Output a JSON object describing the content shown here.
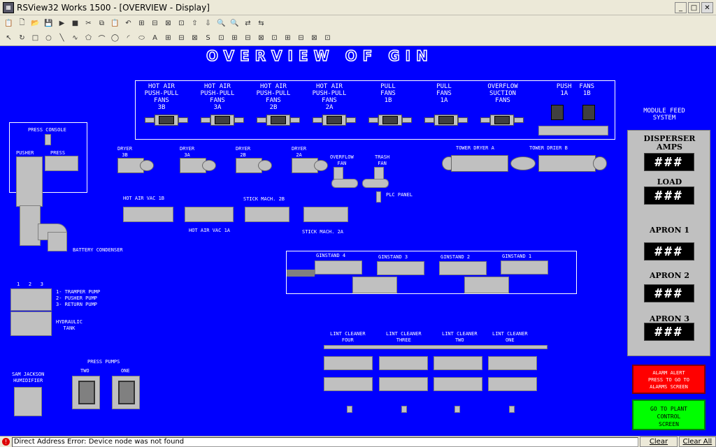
{
  "window": {
    "title": "RSView32 Works 1500 - [OVERVIEW - Display]",
    "min": "_",
    "max": "□",
    "close": "✕"
  },
  "toolbar1": [
    "📋",
    "🗋",
    "📂",
    "💾",
    "▶",
    "■",
    "✂",
    "⧉",
    "📋",
    "↶",
    "⊞",
    "⊟",
    "⊠",
    "⊡",
    "⇧",
    "⇩",
    "🔍",
    "🔍",
    "⇄",
    "⇆"
  ],
  "toolbar2": [
    "↖",
    "↻",
    "□",
    "○",
    "╲",
    "∿",
    "⬠",
    "⌒",
    "◯",
    "◜",
    "⬭",
    "A",
    "⊞",
    "⊟",
    "⊠",
    "S",
    "⊡",
    "⊞",
    "⊟",
    "⊠",
    "⊡",
    "⊞",
    "⊟",
    "⊠",
    "⊡"
  ],
  "screen": {
    "title": "OVERVIEW OF GIN",
    "fans": [
      "HOT AIR\nPUSH-PULL\nFANS\n3B",
      "HOT AIR\nPUSH-PULL\nFANS\n3A",
      "HOT AIR\nPUSH-PULL\nFANS\n2B",
      "HOT AIR\nPUSH-PULL\nFANS\n2A",
      "PULL\nFANS\n1B",
      "PULL\nFANS\n1A",
      "OVERFLOW\nSUCTION\nFANS",
      "PUSH  FANS\n1A    1B"
    ],
    "press_console": "PRESS CONSOLE",
    "pusher": "PUSHER",
    "press": "PRESS",
    "dryers": [
      "DRYER\n3B",
      "DRYER\n3A",
      "DRYER\n2B",
      "DRYER\n2A"
    ],
    "overflow_fan": "OVERFLOW\nFAN",
    "trash_fan": "TRASH\nFAN",
    "plc_panel": "PLC PANEL",
    "tower_dryer_a": "TOWER DRYER A",
    "tower_drier_b": "TOWER DRIER B",
    "hot_air_vac_1b": "HOT AIR VAC 1B",
    "hot_air_vac_1a": "HOT AIR VAC 1A",
    "stick_mach_2b": "STICK MACH. 2B",
    "stick_mach_2a": "STICK MACH. 2A",
    "battery_condenser": "BATTERY CONDENSER",
    "ginstands": [
      "GINSTAND 4",
      "GINSTAND 3",
      "GINSTAND 2",
      "GINSTAND 1"
    ],
    "pump_nums": "1   2   3",
    "pump_legend": "1- TRAMPER PUMP\n2- PUSHER PUMP\n3- RETURN PUMP",
    "hydraulic_tank": "HYDRAULIC\nTANK",
    "lint_cleaners": [
      "LINT CLEANER\nFOUR",
      "LINT CLEANER\nTHREE",
      "LINT CLEANER\nTWO",
      "LINT CLEANER\nONE"
    ],
    "press_pumps": "PRESS PUMPS",
    "press_pump_two": "TWO",
    "press_pump_one": "ONE",
    "humidifier": "SAM JACKSON\nHUMIDIFIER",
    "module_feed": "MODULE FEED\nSYSTEM",
    "disperser_amps": "DISPERSER\nAMPS",
    "load": "LOAD",
    "apron1": "APRON 1",
    "apron2": "APRON 2",
    "apron3": "APRON 3",
    "display_value": "###",
    "alarm_button": "ALARM ALERT\nPRESS TO GO TO\nALARMS SCREEN",
    "goto_button": "GO TO PLANT\nCONTROL\nSCREEN"
  },
  "status": {
    "message": "Direct Address Error: Device node was not found",
    "clear": "Clear",
    "clear_all": "Clear All"
  }
}
